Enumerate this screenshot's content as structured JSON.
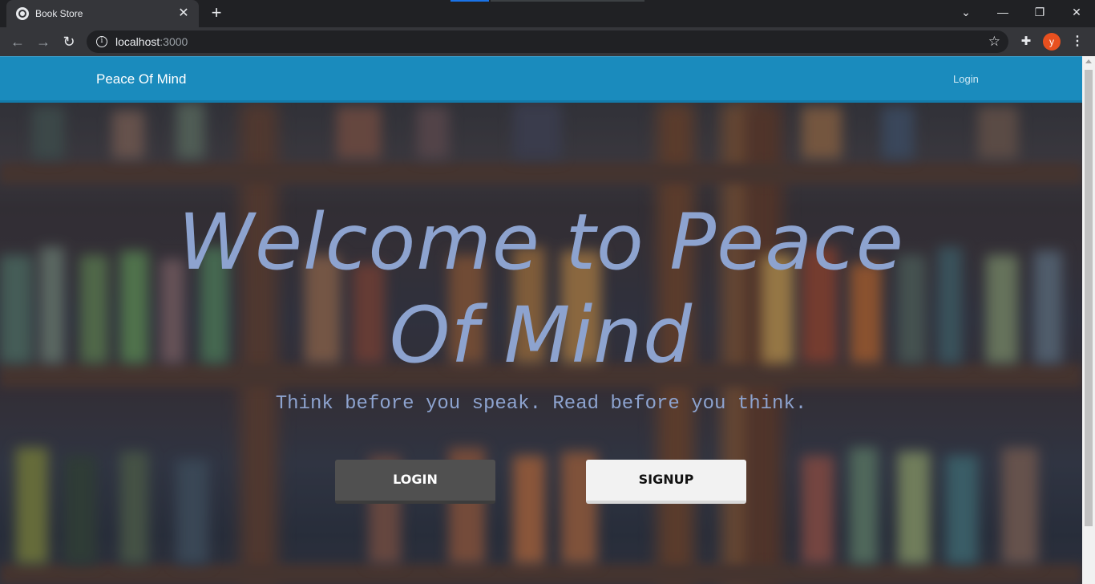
{
  "browser": {
    "tab_title": "Book Store",
    "tab_close": "✕",
    "new_tab": "+",
    "url_host": "localhost",
    "url_port": ":3000",
    "profile_initial": "y",
    "window_controls": [
      "⌄",
      "—",
      "❐",
      "✕"
    ]
  },
  "navbar": {
    "brand": "Peace Of Mind",
    "login_link": "Login"
  },
  "hero": {
    "headline": "Welcome to Peace Of Mind",
    "tagline": "Think before you speak. Read before you think.",
    "login_button": "LOGIN",
    "signup_button": "SIGNUP"
  },
  "colors": {
    "navbar": "#1a8bbd",
    "headline": "#8da3cf",
    "login_button": "#505050",
    "signup_button": "#f2f2f2"
  }
}
